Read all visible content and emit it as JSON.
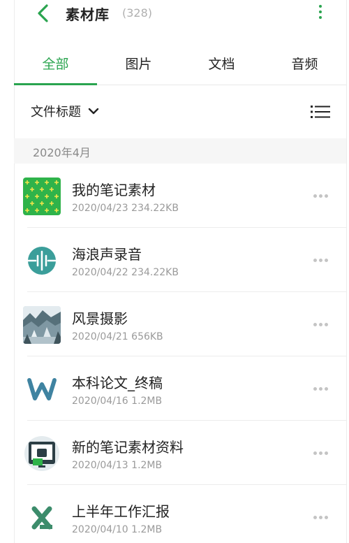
{
  "header": {
    "title": "素材库",
    "count": "(328)",
    "back_icon": "chevron-left-icon",
    "more_icon": "more-vertical-icon",
    "accent_color": "#2aa44f"
  },
  "tabs": [
    {
      "label": "全部",
      "active": true
    },
    {
      "label": "图片",
      "active": false
    },
    {
      "label": "文档",
      "active": false
    },
    {
      "label": "音频",
      "active": false
    }
  ],
  "sort": {
    "label": "文件标题",
    "dropdown_icon": "chevron-down-icon",
    "view_icon": "list-view-icon"
  },
  "section": {
    "label": "2020年4月"
  },
  "files": [
    {
      "name": "我的笔记素材",
      "date": "2020/04/23",
      "size": "234.22KB",
      "thumb": "green-pattern-image"
    },
    {
      "name": "海浪声录音",
      "date": "2020/04/22",
      "size": "234.22KB",
      "thumb": "audio-icon"
    },
    {
      "name": "风景摄影",
      "date": "2020/04/21",
      "size": "656KB",
      "thumb": "landscape-photo"
    },
    {
      "name": "本科论文_终稿",
      "date": "2020/04/16",
      "size": "1.2MB",
      "thumb": "word-doc-icon"
    },
    {
      "name": "新的笔记素材资料",
      "date": "2020/04/13",
      "size": "1.2MB",
      "thumb": "note-screen-image"
    },
    {
      "name": "上半年工作汇报",
      "date": "2020/04/10",
      "size": "1.2MB",
      "thumb": "excel-doc-icon"
    }
  ]
}
